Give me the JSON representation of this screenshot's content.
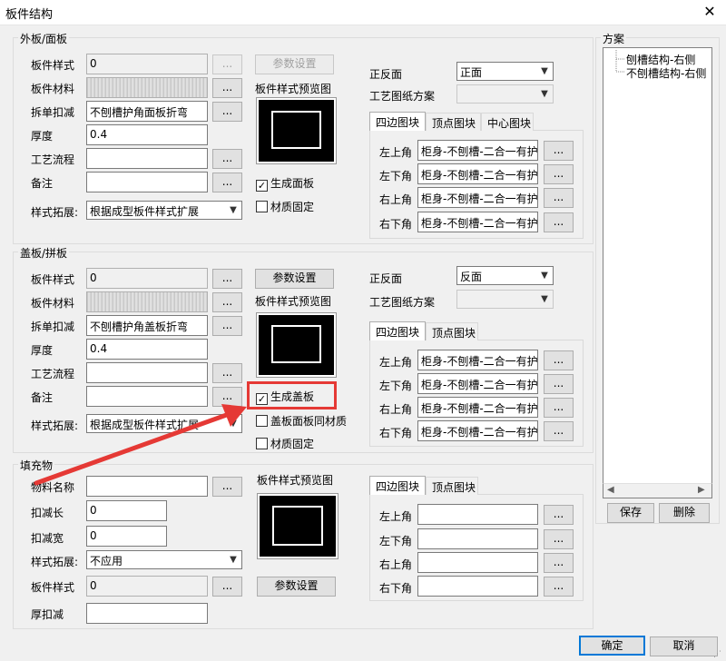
{
  "window": {
    "title": "板件结构",
    "close": "✕"
  },
  "outer": {
    "legend": "外板/面板",
    "style_label": "板件样式",
    "style_value": "0",
    "material_label": "板件材料",
    "split_label": "拆单扣减",
    "split_value": "不刨槽护角面板折弯",
    "thickness_label": "厚度",
    "thickness_value": "0.4",
    "process_label": "工艺流程",
    "process_value": "",
    "note_label": "备注",
    "note_value": "",
    "expand_label": "样式拓展:",
    "expand_value": "根据成型板件样式扩展",
    "param_btn": "参数设置",
    "preview_label": "板件样式预览图",
    "gen_label": "生成面板",
    "gen_checked": true,
    "fix_label": "材质固定",
    "fix_checked": false,
    "face_label": "正反面",
    "face_value": "正面",
    "plan_label": "工艺图纸方案",
    "plan_value": "",
    "tabs": [
      "四边图块",
      "顶点图块",
      "中心图块"
    ],
    "corners": [
      {
        "label": "左上角",
        "value": "柜身-不刨槽-二合一有护"
      },
      {
        "label": "左下角",
        "value": "柜身-不刨槽-二合一有护"
      },
      {
        "label": "右上角",
        "value": "柜身-不刨槽-二合一有护"
      },
      {
        "label": "右下角",
        "value": "柜身-不刨槽-二合一有护"
      }
    ]
  },
  "cover": {
    "legend": "盖板/拼板",
    "style_label": "板件样式",
    "style_value": "0",
    "material_label": "板件材料",
    "split_label": "拆单扣减",
    "split_value": "不刨槽护角盖板折弯",
    "thickness_label": "厚度",
    "thickness_value": "0.4",
    "process_label": "工艺流程",
    "process_value": "",
    "note_label": "备注",
    "note_value": "",
    "expand_label": "样式拓展:",
    "expand_value": "根据成型板件样式扩展",
    "param_btn": "参数设置",
    "preview_label": "板件样式预览图",
    "gen_label": "生成盖板",
    "gen_checked": true,
    "same_label": "盖板面板同材质",
    "same_checked": false,
    "fix_label": "材质固定",
    "fix_checked": false,
    "face_label": "正反面",
    "face_value": "反面",
    "plan_label": "工艺图纸方案",
    "plan_value": "",
    "tabs": [
      "四边图块",
      "顶点图块"
    ],
    "corners": [
      {
        "label": "左上角",
        "value": "柜身-不刨槽-二合一有护"
      },
      {
        "label": "左下角",
        "value": "柜身-不刨槽-二合一有护"
      },
      {
        "label": "右上角",
        "value": "柜身-不刨槽-二合一有护"
      },
      {
        "label": "右下角",
        "value": "柜身-不刨槽-二合一有护"
      }
    ]
  },
  "fill": {
    "legend": "填充物",
    "name_label": "物料名称",
    "name_value": "",
    "dlen_label": "扣减长",
    "dlen_value": "0",
    "dwid_label": "扣减宽",
    "dwid_value": "0",
    "expand_label": "样式拓展:",
    "expand_value": "不应用",
    "style_label": "板件样式",
    "style_value": "0",
    "thick_label": "厚扣减",
    "thick_value": "",
    "preview_label": "板件样式预览图",
    "param_btn": "参数设置",
    "tabs": [
      "四边图块",
      "顶点图块"
    ],
    "corners": [
      {
        "label": "左上角",
        "value": ""
      },
      {
        "label": "左下角",
        "value": ""
      },
      {
        "label": "右上角",
        "value": ""
      },
      {
        "label": "右下角",
        "value": ""
      }
    ]
  },
  "plans": {
    "legend": "方案",
    "items": [
      "刨槽结构-右侧",
      "不刨槽结构-右侧"
    ],
    "save": "保存",
    "delete": "删除"
  },
  "footer": {
    "ok": "确定",
    "cancel": "取消"
  },
  "ellipsis": "...",
  "check_mark": "✓",
  "colors": {
    "highlight": "#e53935",
    "preview_bg": "#000000"
  }
}
